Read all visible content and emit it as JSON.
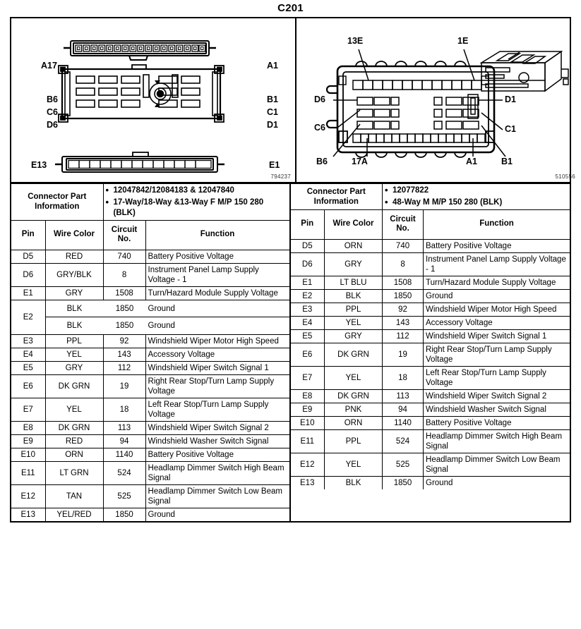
{
  "title": "C201",
  "diagrams": {
    "left": {
      "ref_no": "794237",
      "labels": {
        "a17": "A17",
        "a1": "A1",
        "b6": "B6",
        "c6": "C6",
        "d6": "D6",
        "b1": "B1",
        "c1": "C1",
        "d1": "D1",
        "e13": "E13",
        "e1": "E1"
      }
    },
    "right": {
      "ref_no": "510556",
      "labels": {
        "l13e": "13E",
        "l1e": "1E",
        "d6": "D6",
        "d1": "D1",
        "c6": "C6",
        "c1": "C1",
        "b6": "B6",
        "l17a": "17A",
        "a1": "A1",
        "b1": "B1"
      }
    }
  },
  "left_table": {
    "connector_part_information_label": "Connector Part Information",
    "connector_part_information_values": [
      "12047842/12084183 & 12047840",
      "17-Way/18-Way &13-Way F M/P 150 280 (BLK)"
    ],
    "headers": {
      "pin": "Pin",
      "wire_color": "Wire Color",
      "circuit_no": "Circuit No.",
      "function": "Function"
    },
    "rows": [
      {
        "pin": "D5",
        "wire_color": "RED",
        "circuit_no": "740",
        "function": "Battery Positive Voltage"
      },
      {
        "pin": "D6",
        "wire_color": "GRY/BLK",
        "circuit_no": "8",
        "function": "Instrument Panel Lamp Supply Voltage - 1"
      },
      {
        "pin": "E1",
        "wire_color": "GRY",
        "circuit_no": "1508",
        "function": "Turn/Hazard Module Supply Voltage"
      },
      {
        "pin": "E2",
        "sub": [
          {
            "wire_color": "BLK",
            "circuit_no": "1850",
            "function": "Ground"
          },
          {
            "wire_color": "BLK",
            "circuit_no": "1850",
            "function": "Ground"
          }
        ]
      },
      {
        "pin": "E3",
        "wire_color": "PPL",
        "circuit_no": "92",
        "function": "Windshield Wiper Motor High Speed"
      },
      {
        "pin": "E4",
        "wire_color": "YEL",
        "circuit_no": "143",
        "function": "Accessory Voltage"
      },
      {
        "pin": "E5",
        "wire_color": "GRY",
        "circuit_no": "112",
        "function": "Windshield Wiper Switch Signal 1"
      },
      {
        "pin": "E6",
        "wire_color": "DK GRN",
        "circuit_no": "19",
        "function": "Right Rear Stop/Turn Lamp Supply Voltage"
      },
      {
        "pin": "E7",
        "wire_color": "YEL",
        "circuit_no": "18",
        "function": "Left Rear Stop/Turn Lamp Supply Voltage"
      },
      {
        "pin": "E8",
        "wire_color": "DK GRN",
        "circuit_no": "113",
        "function": "Windshield Wiper Switch Signal 2"
      },
      {
        "pin": "E9",
        "wire_color": "RED",
        "circuit_no": "94",
        "function": "Windshield Washer Switch Signal"
      },
      {
        "pin": "E10",
        "wire_color": "ORN",
        "circuit_no": "1140",
        "function": "Battery Positive Voltage"
      },
      {
        "pin": "E11",
        "wire_color": "LT GRN",
        "circuit_no": "524",
        "function": "Headlamp Dimmer Switch High Beam Signal"
      },
      {
        "pin": "E12",
        "wire_color": "TAN",
        "circuit_no": "525",
        "function": "Headlamp Dimmer Switch Low Beam Signal"
      },
      {
        "pin": "E13",
        "wire_color": "YEL/RED",
        "circuit_no": "1850",
        "function": "Ground"
      }
    ]
  },
  "right_table": {
    "connector_part_information_label": "Connector Part Information",
    "connector_part_information_values": [
      "12077822",
      "48-Way M M/P 150 280 (BLK)"
    ],
    "headers": {
      "pin": "Pin",
      "wire_color": "Wire Color",
      "circuit_no": "Circuit No.",
      "function": "Function"
    },
    "rows": [
      {
        "pin": "D5",
        "wire_color": "ORN",
        "circuit_no": "740",
        "function": "Battery Positive Voltage"
      },
      {
        "pin": "D6",
        "wire_color": "GRY",
        "circuit_no": "8",
        "function": "Instrument Panel Lamp Supply Voltage - 1"
      },
      {
        "pin": "E1",
        "wire_color": "LT BLU",
        "circuit_no": "1508",
        "function": "Turn/Hazard Module Supply Voltage"
      },
      {
        "pin": "E2",
        "wire_color": "BLK",
        "circuit_no": "1850",
        "function": "Ground"
      },
      {
        "pin": "E3",
        "wire_color": "PPL",
        "circuit_no": "92",
        "function": "Windshield Wiper Motor High Speed"
      },
      {
        "pin": "E4",
        "wire_color": "YEL",
        "circuit_no": "143",
        "function": "Accessory Voltage"
      },
      {
        "pin": "E5",
        "wire_color": "GRY",
        "circuit_no": "112",
        "function": "Windshield Wiper Switch Signal 1"
      },
      {
        "pin": "E6",
        "wire_color": "DK GRN",
        "circuit_no": "19",
        "function": "Right Rear Stop/Turn Lamp Supply Voltage"
      },
      {
        "pin": "E7",
        "wire_color": "YEL",
        "circuit_no": "18",
        "function": "Left Rear Stop/Turn Lamp Supply Voltage"
      },
      {
        "pin": "E8",
        "wire_color": "DK GRN",
        "circuit_no": "113",
        "function": "Windshield Wiper Switch Signal 2"
      },
      {
        "pin": "E9",
        "wire_color": "PNK",
        "circuit_no": "94",
        "function": "Windshield Washer Switch Signal"
      },
      {
        "pin": "E10",
        "wire_color": "ORN",
        "circuit_no": "1140",
        "function": "Battery Positive Voltage"
      },
      {
        "pin": "E11",
        "wire_color": "PPL",
        "circuit_no": "524",
        "function": "Headlamp Dimmer Switch High Beam Signal"
      },
      {
        "pin": "E12",
        "wire_color": "YEL",
        "circuit_no": "525",
        "function": "Headlamp Dimmer Switch Low Beam Signal"
      },
      {
        "pin": "E13",
        "wire_color": "BLK",
        "circuit_no": "1850",
        "function": "Ground"
      }
    ]
  }
}
